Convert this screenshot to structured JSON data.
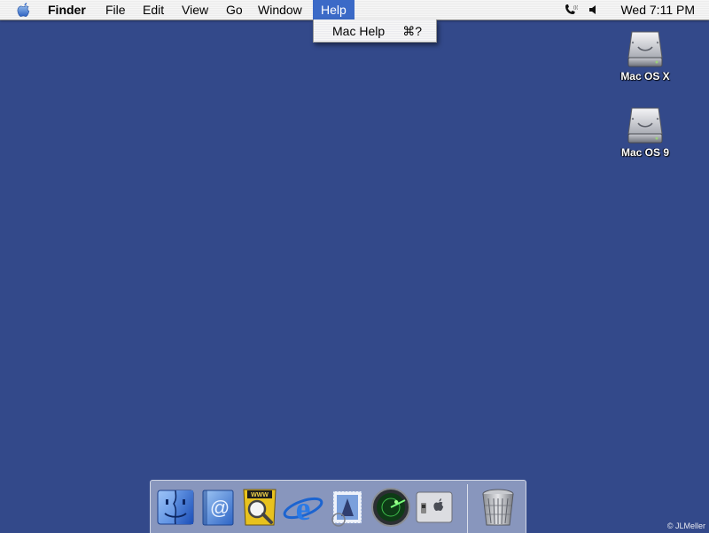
{
  "menubar": {
    "apple_icon": "apple-logo-icon",
    "app_name": "Finder",
    "items": [
      "File",
      "Edit",
      "View",
      "Go",
      "Window",
      "Help"
    ],
    "active_item": "Help",
    "status_icons": [
      "phone-icon",
      "volume-icon"
    ],
    "clock": "Wed 7:11 PM"
  },
  "help_menu": {
    "items": [
      {
        "label": "Mac Help",
        "shortcut": "⌘?"
      }
    ]
  },
  "desktop": {
    "background_color": "#33498a",
    "icons": [
      {
        "label": "Mac OS X",
        "icon": "hard-drive-icon"
      },
      {
        "label": "Mac OS 9",
        "icon": "hard-drive-icon"
      }
    ]
  },
  "dock": {
    "apps": [
      {
        "name": "Finder",
        "icon": "finder-icon"
      },
      {
        "name": "Mail",
        "icon": "mail-icon"
      },
      {
        "name": "Sherlock",
        "icon": "sherlock-icon"
      },
      {
        "name": "Internet Explorer",
        "icon": "internet-explorer-icon"
      },
      {
        "name": "Mail Stamp",
        "icon": "mail-stamp-icon"
      },
      {
        "name": "Network Utility",
        "icon": "radar-icon"
      },
      {
        "name": "System Preferences",
        "icon": "system-preferences-icon"
      }
    ],
    "trash": {
      "name": "Trash",
      "icon": "trash-icon"
    }
  },
  "watermark": "© JLMeller"
}
